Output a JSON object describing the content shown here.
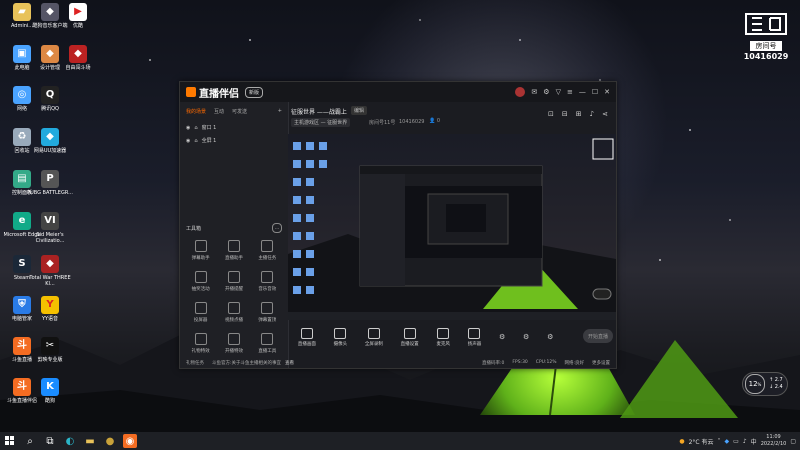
{
  "desktop": {
    "icons": [
      {
        "label": "Admini...",
        "glyph": "folder-icon",
        "color": "#e8c25a"
      },
      {
        "label": "酷狗音乐客户端",
        "glyph": "app-icon",
        "color": "#556"
      },
      {
        "label": "优酷",
        "glyph": "youku-icon",
        "color": "#fff"
      },
      {
        "label": "此电脑",
        "glyph": "computer-icon",
        "color": "#4aa3ff"
      },
      {
        "label": "设计管理",
        "glyph": "app-icon",
        "color": "#d84"
      },
      {
        "label": "自由闯斗场",
        "glyph": "app-icon",
        "color": "#b22"
      },
      {
        "label": "网络",
        "glyph": "network-icon",
        "color": "#4aa3ff"
      },
      {
        "label": "腾讯QQ",
        "glyph": "qq-icon",
        "color": "#222"
      },
      {
        "label": "回收站",
        "glyph": "recycle-bin-icon",
        "color": "#9ab"
      },
      {
        "label": "网易UU加速器",
        "glyph": "app-icon",
        "color": "#2ad"
      },
      {
        "label": "控制面板",
        "glyph": "control-panel-icon",
        "color": "#3a8"
      },
      {
        "label": "PUBG BATTLEGR...",
        "glyph": "pubg-icon",
        "color": "#555"
      },
      {
        "label": "Microsoft Edge",
        "glyph": "edge-icon",
        "color": "#1a8"
      },
      {
        "label": "Sid Meier's Civilizatio...",
        "glyph": "civ-icon",
        "color": "#444"
      },
      {
        "label": "Steam",
        "glyph": "steam-icon",
        "color": "#1b2838"
      },
      {
        "label": "Total War THREE KI...",
        "glyph": "app-icon",
        "color": "#a22"
      },
      {
        "label": "电脑管家",
        "glyph": "shield-icon",
        "color": "#2a7be6"
      },
      {
        "label": "YY语音",
        "glyph": "yy-icon",
        "color": "#f5c000"
      },
      {
        "label": "斗鱼直播",
        "glyph": "douyu-icon",
        "color": "#f46c22"
      },
      {
        "label": "剪映专业版",
        "glyph": "capcut-icon",
        "color": "#111"
      },
      {
        "label": "斗鱼直播伴侣",
        "glyph": "douyu-icon",
        "color": "#f46c22"
      },
      {
        "label": "酷狗",
        "glyph": "kugou-icon",
        "color": "#1a8cff"
      }
    ]
  },
  "douyu_badge": {
    "room_label": "房间号",
    "room_number": "10416029"
  },
  "app": {
    "logo_text": "直播伴侣",
    "version_badge": "新版",
    "tabs": [
      "我的场景",
      "互动",
      "可发送"
    ],
    "sources": [
      "窗口 1",
      "全屏 1"
    ],
    "toolbox_title": "工具箱",
    "tools": [
      "弹幕助手",
      "直播助手",
      "主播任务",
      "抽奖活动",
      "开播提醒",
      "音乐音效",
      "投屏器",
      "视频点播",
      "弹幕置顶",
      "礼物特效",
      "开播特效",
      "直播工具"
    ],
    "stream_title": "征服世界 ——战霸上",
    "title_edit": "编辑",
    "category": "主机游戏区 — 征服世界",
    "room_info": "房间号11号",
    "room_id": "10416029",
    "viewers": "0",
    "bottom_tools": [
      "直播画面",
      "摄像头",
      "全屏录制",
      "直播设置",
      "麦克风",
      "扬声器"
    ],
    "start_live": "开始直播",
    "status": {
      "left": "礼物任务",
      "middle": "斗鱼官方:关于斗鱼主播相关的事宜",
      "middle2": "查看",
      "bitrate": "直播码率:0",
      "fps": "FPS:30",
      "cpu": "CPU:12%",
      "net": "网络:良好",
      "more": "更多设置"
    }
  },
  "taskbar": {
    "weather": "2°C 有云",
    "time": "11:09",
    "date": "2022/2/10",
    "lang": "中"
  },
  "gauge": {
    "value": "12",
    "unit": "%",
    "up": "2.7",
    "down": "2.4"
  }
}
